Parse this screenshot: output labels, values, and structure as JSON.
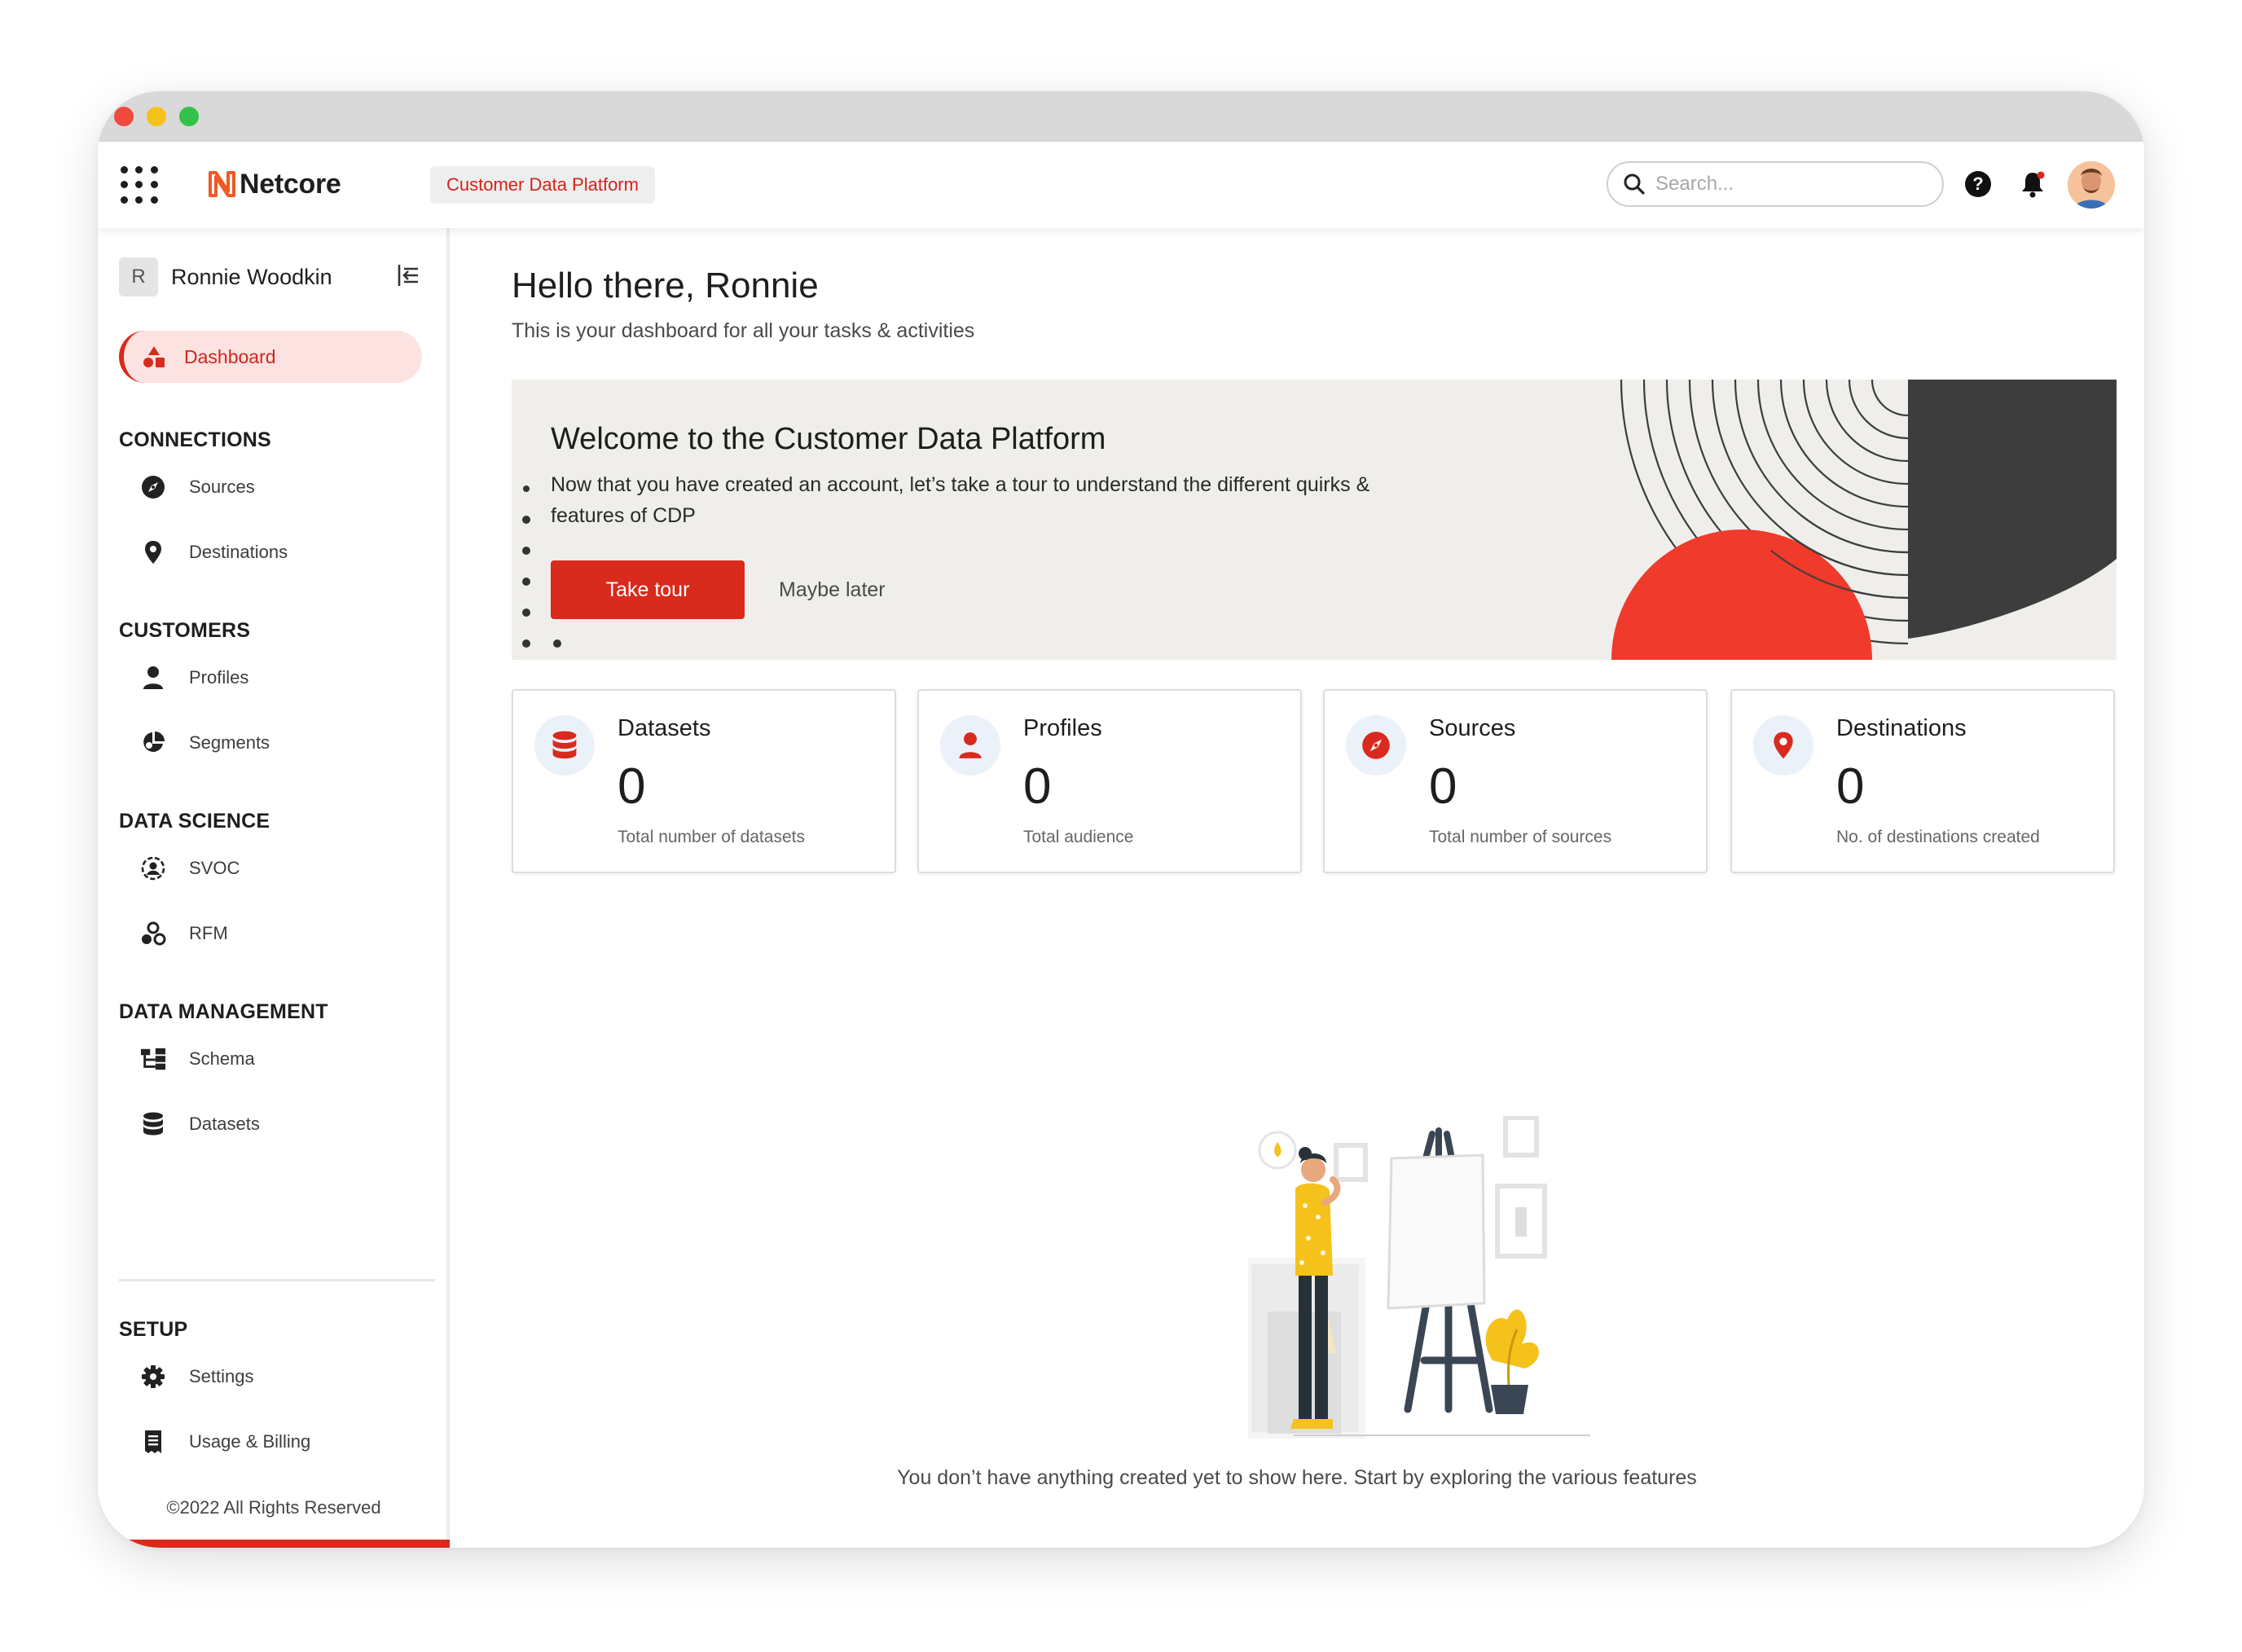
{
  "window": {
    "controls": [
      "close",
      "minimize",
      "maximize"
    ]
  },
  "topnav": {
    "logo_text": "Netcore",
    "product_label": "Customer Data Platform",
    "search": {
      "placeholder": "Search..."
    },
    "help_glyph": "?",
    "icons": [
      "apps-grid-icon",
      "help-icon",
      "bell-icon",
      "avatar"
    ]
  },
  "sidebar": {
    "user": {
      "initial": "R",
      "name": "Ronnie Woodkin"
    },
    "active_item": {
      "label": "Dashboard",
      "icon": "dashboard-icon"
    },
    "sections": [
      {
        "title": "CONNECTIONS",
        "items": [
          {
            "label": "Sources",
            "icon": "compass-icon"
          },
          {
            "label": "Destinations",
            "icon": "location-pin-icon"
          }
        ]
      },
      {
        "title": "CUSTOMERS",
        "items": [
          {
            "label": "Profiles",
            "icon": "person-icon"
          },
          {
            "label": "Segments",
            "icon": "segments-icon"
          }
        ]
      },
      {
        "title": "DATA SCIENCE",
        "items": [
          {
            "label": "SVOC",
            "icon": "svoc-icon"
          },
          {
            "label": "RFM",
            "icon": "rfm-icon"
          }
        ]
      },
      {
        "title": "DATA MANAGEMENT",
        "items": [
          {
            "label": "Schema",
            "icon": "schema-icon"
          },
          {
            "label": "Datasets",
            "icon": "database-icon"
          }
        ]
      },
      {
        "title": "SETUP",
        "items": [
          {
            "label": "Settings",
            "icon": "gear-icon"
          },
          {
            "label": "Usage & Billing",
            "icon": "receipt-icon"
          }
        ]
      }
    ],
    "copyright": "©2022 All Rights Reserved"
  },
  "main": {
    "greeting": "Hello there, Ronnie",
    "subtitle": "This is your dashboard for all your tasks & activities",
    "banner": {
      "title": "Welcome to the Customer Data Platform",
      "text": "Now that you have created an account, let’s take a tour to understand the different quirks & features of CDP",
      "primary_button": "Take tour",
      "secondary_button": "Maybe later"
    },
    "cards": [
      {
        "title": "Datasets",
        "value": "0",
        "desc": "Total number of datasets",
        "icon": "database-icon"
      },
      {
        "title": "Profiles",
        "value": "0",
        "desc": "Total audience",
        "icon": "person-icon"
      },
      {
        "title": "Sources",
        "value": "0",
        "desc": "Total number of sources",
        "icon": "compass-icon"
      },
      {
        "title": "Destinations",
        "value": "0",
        "desc": "No. of destinations created",
        "icon": "location-pin-icon"
      }
    ],
    "empty_state": "You don’t have anything created yet to show here. Start by exploring the various features"
  },
  "colors": {
    "accent": "#d82a1d",
    "accent_light": "#fce3e1",
    "banner_bg": "#efeeeb",
    "card_icon_bg": "#ebf1f9",
    "banner_dark": "#3d3d3d",
    "banner_red": "#f03a2c"
  }
}
